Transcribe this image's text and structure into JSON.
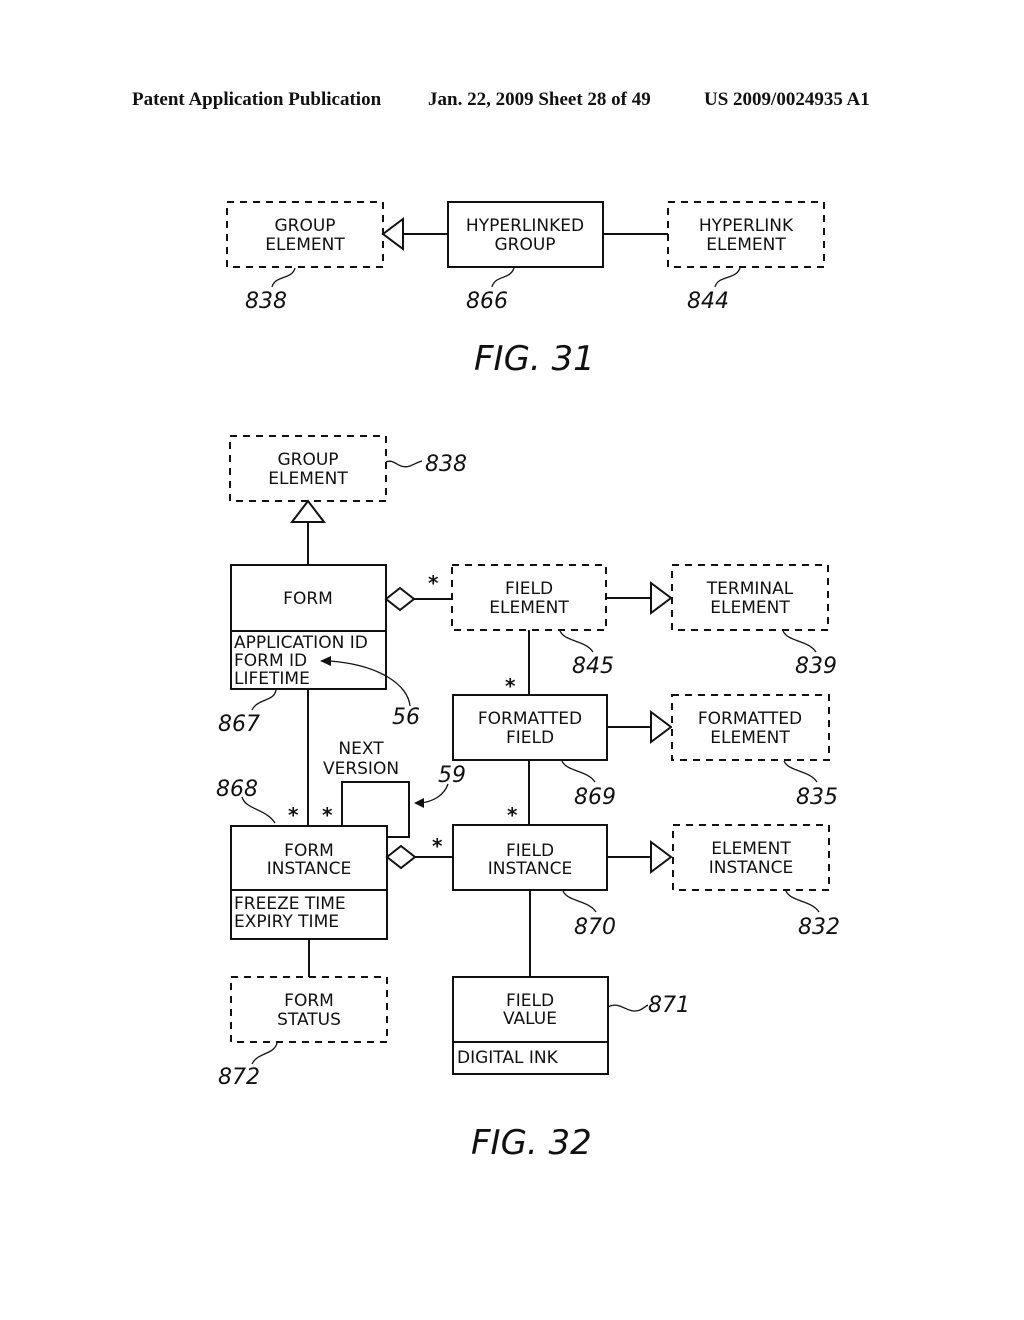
{
  "header": {
    "publication": "Patent Application Publication",
    "date_sheet": "Jan. 22, 2009  Sheet 28 of 49",
    "number": "US 2009/0024935 A1"
  },
  "fig31": {
    "caption": "FIG. 31",
    "group_element": {
      "line1": "GROUP",
      "line2": "ELEMENT",
      "ref": "838"
    },
    "hyperlinked_group": {
      "line1": "HYPERLINKED",
      "line2": "GROUP",
      "ref": "866"
    },
    "hyperlink_element": {
      "line1": "HYPERLINK",
      "line2": "ELEMENT",
      "ref": "844"
    }
  },
  "fig32": {
    "caption": "FIG. 32",
    "group_element": {
      "line1": "GROUP",
      "line2": "ELEMENT",
      "ref": "838"
    },
    "form": {
      "title": "FORM",
      "attrs": [
        "APPLICATION ID",
        "FORM ID",
        "LIFETIME"
      ],
      "ref": "867",
      "arrow_ref": "56"
    },
    "field_element": {
      "line1": "FIELD",
      "line2": "ELEMENT",
      "ref": "845"
    },
    "terminal_element": {
      "line1": "TERMINAL",
      "line2": "ELEMENT",
      "ref": "839"
    },
    "formatted_field": {
      "line1": "FORMATTED",
      "line2": "FIELD",
      "ref": "869"
    },
    "formatted_element": {
      "line1": "FORMATTED",
      "line2": "ELEMENT",
      "ref": "835"
    },
    "next_version": {
      "line1": "NEXT",
      "line2": "VERSION",
      "ref": "59"
    },
    "form_instance": {
      "line1": "FORM",
      "line2": "INSTANCE",
      "attrs": [
        "FREEZE TIME",
        "EXPIRY TIME"
      ],
      "ref": "868"
    },
    "field_instance": {
      "line1": "FIELD",
      "line2": "INSTANCE",
      "ref": "870"
    },
    "element_instance": {
      "line1": "ELEMENT",
      "line2": "INSTANCE",
      "ref": "832"
    },
    "form_status": {
      "line1": "FORM",
      "line2": "STATUS",
      "ref": "872"
    },
    "field_value": {
      "line1": "FIELD",
      "line2": "VALUE",
      "attrs": [
        "DIGITAL INK"
      ],
      "ref": "871"
    },
    "multiplicity": "*"
  }
}
